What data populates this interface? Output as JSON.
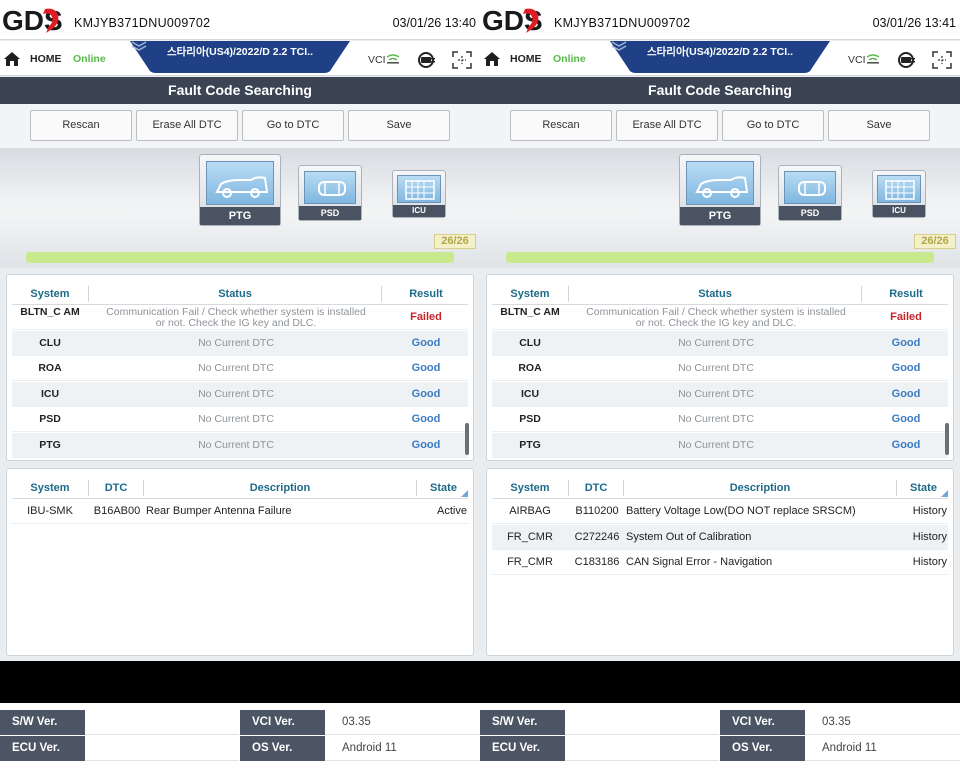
{
  "panes": [
    {
      "app_logo": "GDS",
      "vin": "KMJYB371DNU009702",
      "datetime": "03/01/26 13:40",
      "nav": {
        "home_label": "HOME",
        "status": "Online",
        "vehicle": "스타리아(US4)/2022/D 2.2 TCI..",
        "vci_label": "VCI"
      },
      "page_title": "Fault Code Searching",
      "toolbar": {
        "rescan": "Rescan",
        "erase": "Erase All DTC",
        "goto": "Go to DTC",
        "save": "Save"
      },
      "modules": [
        "PTG",
        "PSD",
        "ICU"
      ],
      "progress": {
        "count": "26/26",
        "fraction": 1.0
      },
      "system_table": {
        "headers": [
          "System",
          "Status",
          "Result"
        ],
        "rows": [
          {
            "system": "BLTN_C AM",
            "status": "Communication Fail / Check whether system is installed or not. Check the IG key and DLC.",
            "result": "Failed"
          },
          {
            "system": "CLU",
            "status": "No Current DTC",
            "result": "Good"
          },
          {
            "system": "ROA",
            "status": "No Current DTC",
            "result": "Good"
          },
          {
            "system": "ICU",
            "status": "No Current DTC",
            "result": "Good"
          },
          {
            "system": "PSD",
            "status": "No Current DTC",
            "result": "Good"
          },
          {
            "system": "PTG",
            "status": "No Current DTC",
            "result": "Good"
          }
        ]
      },
      "dtc_table": {
        "headers": [
          "System",
          "DTC",
          "Description",
          "State"
        ],
        "rows": [
          {
            "system": "IBU-SMK",
            "dtc": "B16AB00",
            "description": "Rear Bumper Antenna Failure",
            "state": "Active"
          }
        ]
      },
      "footer": {
        "sw_label": "S/W Ver.",
        "sw_value": "",
        "vci_label": "VCI Ver.",
        "vci_value": "03.35",
        "ecu_label": "ECU Ver.",
        "ecu_value": "",
        "os_label": "OS Ver.",
        "os_value": "Android 11"
      }
    },
    {
      "app_logo": "GDS",
      "vin": "KMJYB371DNU009702",
      "datetime": "03/01/26 13:41",
      "nav": {
        "home_label": "HOME",
        "status": "Online",
        "vehicle": "스타리아(US4)/2022/D 2.2 TCI..",
        "vci_label": "VCI"
      },
      "page_title": "Fault Code Searching",
      "toolbar": {
        "rescan": "Rescan",
        "erase": "Erase All DTC",
        "goto": "Go to DTC",
        "save": "Save"
      },
      "modules": [
        "PTG",
        "PSD",
        "ICU"
      ],
      "progress": {
        "count": "26/26",
        "fraction": 1.0
      },
      "system_table": {
        "headers": [
          "System",
          "Status",
          "Result"
        ],
        "rows": [
          {
            "system": "BLTN_C AM",
            "status": "Communication Fail / Check whether system is installed or not. Check the IG key and DLC.",
            "result": "Failed"
          },
          {
            "system": "CLU",
            "status": "No Current DTC",
            "result": "Good"
          },
          {
            "system": "ROA",
            "status": "No Current DTC",
            "result": "Good"
          },
          {
            "system": "ICU",
            "status": "No Current DTC",
            "result": "Good"
          },
          {
            "system": "PSD",
            "status": "No Current DTC",
            "result": "Good"
          },
          {
            "system": "PTG",
            "status": "No Current DTC",
            "result": "Good"
          }
        ]
      },
      "dtc_table": {
        "headers": [
          "System",
          "DTC",
          "Description",
          "State"
        ],
        "rows": [
          {
            "system": "AIRBAG",
            "dtc": "B110200",
            "description": "Battery Voltage Low(DO NOT replace SRSCM)",
            "state": "History"
          },
          {
            "system": "FR_CMR",
            "dtc": "C272246",
            "description": "System Out of Calibration",
            "state": "History"
          },
          {
            "system": "FR_CMR",
            "dtc": "C183186",
            "description": "CAN Signal Error - Navigation",
            "state": "History"
          }
        ]
      },
      "footer": {
        "sw_label": "S/W Ver.",
        "sw_value": "",
        "vci_label": "VCI Ver.",
        "vci_value": "03.35",
        "ecu_label": "ECU Ver.",
        "ecu_value": "",
        "os_label": "OS Ver.",
        "os_value": "Android 11"
      }
    }
  ],
  "colors": {
    "header_dark": "#3a4452",
    "vehicle_tab": "#1f3f86",
    "online": "#58b94a",
    "good": "#3b7bc2",
    "failed": "#c6242b",
    "progress": "#c9e98d",
    "logo_red": "#e21b23"
  }
}
